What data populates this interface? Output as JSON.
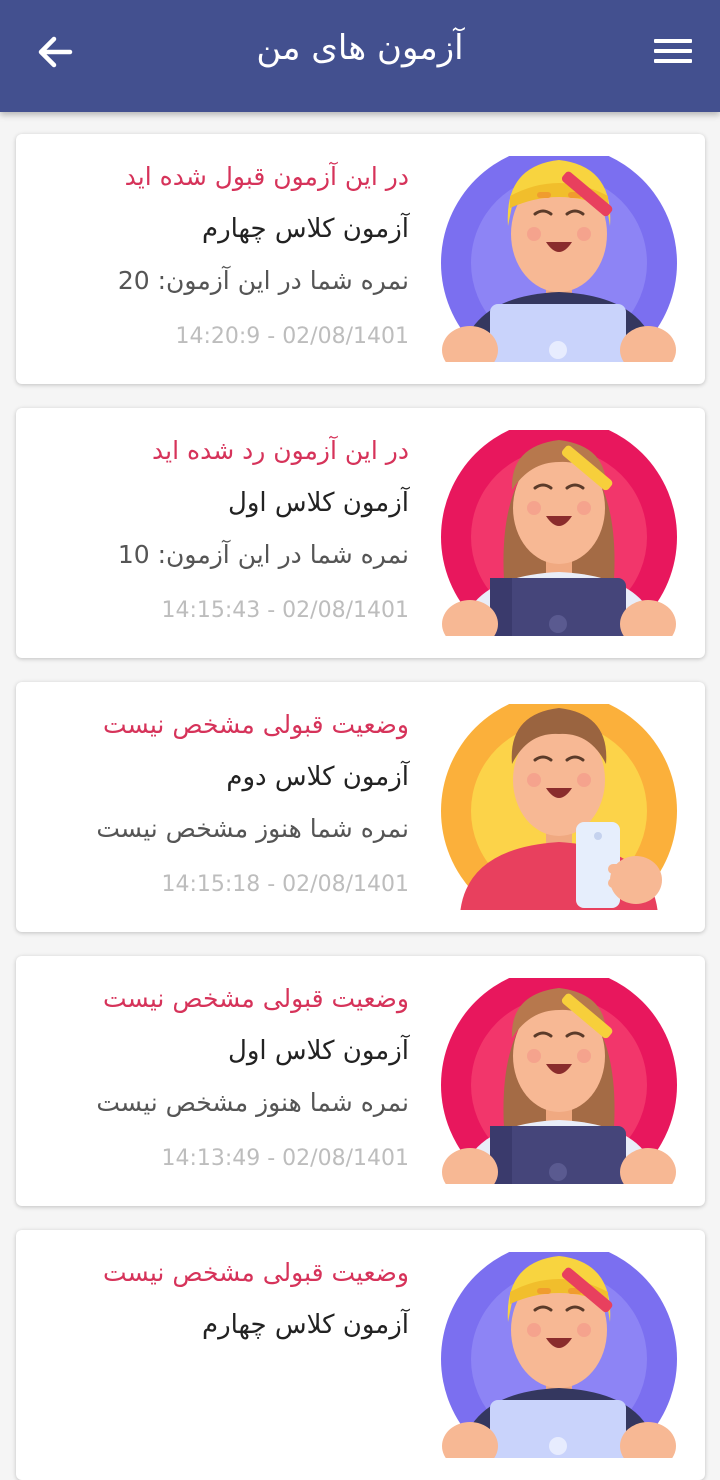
{
  "header": {
    "title": "آزمون های من",
    "back_icon": "arrow-left-icon",
    "menu_icon": "hamburger-menu-icon",
    "color": "#43508f"
  },
  "colors": {
    "status": "#d6335a",
    "date": "#bdbdbd"
  },
  "exams": [
    {
      "status": "در این آزمون قبول شده اید",
      "name": "آزمون کلاس چهارم",
      "score": "نمره شما در این آزمون: 20",
      "date": "14:20:9 - 02/08/1401",
      "avatar": "blonde-student-laptop-avatar"
    },
    {
      "status": "در این آزمون رد شده اید",
      "name": "آزمون کلاس اول",
      "score": "نمره شما در این آزمون: 10",
      "date": "14:15:43 - 02/08/1401",
      "avatar": "brunette-student-laptop-avatar"
    },
    {
      "status": "وضعیت قبولی مشخص نیست",
      "name": "آزمون کلاس دوم",
      "score": "نمره شما هنوز مشخص نیست",
      "date": "14:15:18 - 02/08/1401",
      "avatar": "student-phone-avatar"
    },
    {
      "status": "وضعیت قبولی مشخص نیست",
      "name": "آزمون کلاس اول",
      "score": "نمره شما هنوز مشخص نیست",
      "date": "14:13:49 - 02/08/1401",
      "avatar": "brunette-student-laptop-avatar"
    },
    {
      "status": "وضعیت قبولی مشخص نیست",
      "name": "آزمون کلاس چهارم",
      "score": "",
      "date": "",
      "avatar": "blonde-student-laptop-avatar"
    }
  ]
}
